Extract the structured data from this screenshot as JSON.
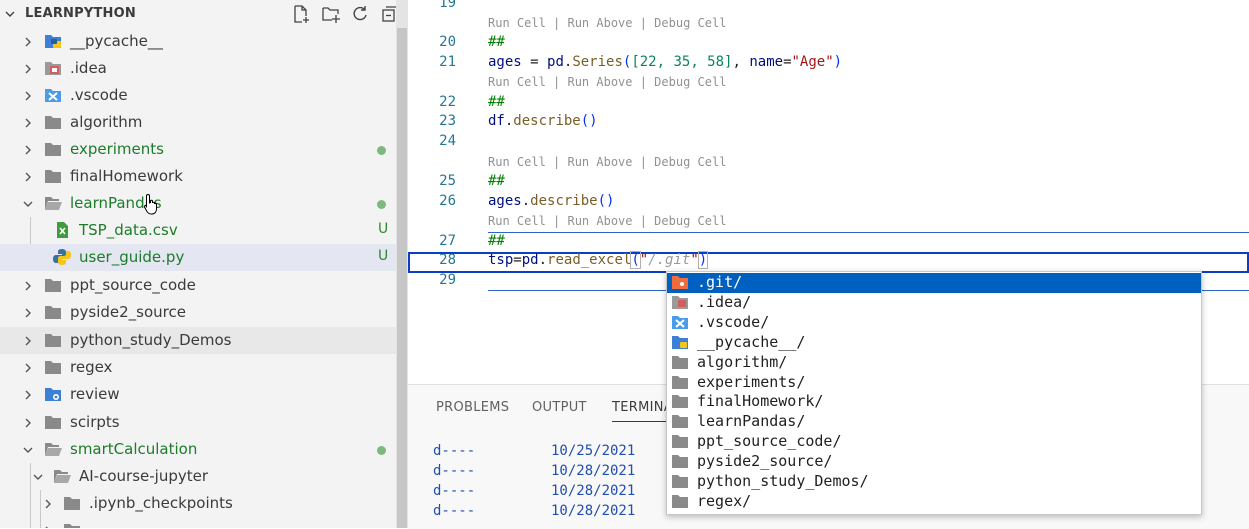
{
  "sidebar": {
    "title": "LEARNPYTHON",
    "tree": [
      {
        "label": "__pycache__",
        "icon": "python-cache-folder-icon",
        "status": ""
      },
      {
        "label": ".idea",
        "icon": "idea-folder-icon",
        "status": ""
      },
      {
        "label": ".vscode",
        "icon": "vscode-folder-icon",
        "status": ""
      },
      {
        "label": "algorithm",
        "icon": "folder-icon",
        "status": ""
      },
      {
        "label": "experiments",
        "icon": "folder-icon",
        "status": "modified"
      },
      {
        "label": "finalHomework",
        "icon": "folder-icon",
        "status": ""
      },
      {
        "label": "learnPandas",
        "icon": "folder-open-icon",
        "status": "modified"
      },
      {
        "label": "TSP_data.csv",
        "icon": "csv-file-icon",
        "status": "U"
      },
      {
        "label": "user_guide.py",
        "icon": "python-file-icon",
        "status": "U"
      },
      {
        "label": "ppt_source_code",
        "icon": "folder-icon",
        "status": ""
      },
      {
        "label": "pyside2_source",
        "icon": "folder-icon",
        "status": ""
      },
      {
        "label": "python_study_Demos",
        "icon": "folder-icon",
        "status": ""
      },
      {
        "label": "regex",
        "icon": "folder-icon",
        "status": ""
      },
      {
        "label": "review",
        "icon": "folder-icon",
        "status": ""
      },
      {
        "label": "scirpts",
        "icon": "folder-icon",
        "status": ""
      },
      {
        "label": "smartCalculation",
        "icon": "folder-open-icon",
        "status": "modified"
      },
      {
        "label": "AI-course-jupyter",
        "icon": "folder-open-icon",
        "status": ""
      },
      {
        "label": ".ipynb_checkpoints",
        "icon": "folder-icon",
        "status": ""
      }
    ]
  },
  "editor": {
    "codelens": "Run Cell | Run Above | Debug Cell",
    "line_numbers": [
      "19",
      "20",
      "21",
      "22",
      "23",
      "24",
      "25",
      "26",
      "27",
      "28",
      "29"
    ],
    "lines": {
      "l20": "##",
      "l21_var": "ages",
      "l21_eq": " = ",
      "l21_obj": "pd",
      "l21_dot": ".",
      "l21_fn": "Series",
      "l21_open": "(",
      "l21_list": "[22, 35, 58]",
      "l21_sep": ", ",
      "l21_kw": "name",
      "l21_eq2": "=",
      "l21_str": "\"Age\"",
      "l21_close": ")",
      "l22": "##",
      "l23_obj": "df",
      "l23_dot": ".",
      "l23_fn": "describe",
      "l23_par": "()",
      "l25": "##",
      "l26_obj": "ages",
      "l26_dot": ".",
      "l26_fn": "describe",
      "l26_par": "()",
      "l27": "##",
      "l28_var": "tsp",
      "l28_eq": "=",
      "l28_obj": "pd",
      "l28_dot": ".",
      "l28_fn": "read_excel",
      "l28_open": "(",
      "l28_str": "\"",
      "l28_ghost": "/.git",
      "l28_strend": "\"",
      "l28_close": ")"
    }
  },
  "panel": {
    "tabs": [
      "PROBLEMS",
      "OUTPUT",
      "TERMINAL"
    ],
    "active_tab": "TERMINAL",
    "terminal_rows": [
      {
        "mode": "d----",
        "date": "10/25/2021"
      },
      {
        "mode": "d----",
        "date": "10/28/2021"
      },
      {
        "mode": "d----",
        "date": "10/28/2021"
      },
      {
        "mode": "d----",
        "date": "10/28/2021"
      }
    ]
  },
  "suggest": {
    "items": [
      {
        "label": ".git/",
        "icon": "git-folder-icon"
      },
      {
        "label": ".idea/",
        "icon": "idea-folder-icon"
      },
      {
        "label": ".vscode/",
        "icon": "vscode-folder-icon"
      },
      {
        "label": "__pycache__/",
        "icon": "python-cache-folder-icon"
      },
      {
        "label": "algorithm/",
        "icon": "folder-icon"
      },
      {
        "label": "experiments/",
        "icon": "folder-icon"
      },
      {
        "label": "finalHomework/",
        "icon": "folder-icon"
      },
      {
        "label": "learnPandas/",
        "icon": "folder-icon"
      },
      {
        "label": "ppt_source_code/",
        "icon": "folder-icon"
      },
      {
        "label": "pyside2_source/",
        "icon": "folder-icon"
      },
      {
        "label": "python_study_Demos/",
        "icon": "folder-icon"
      },
      {
        "label": "regex/",
        "icon": "folder-icon"
      }
    ]
  },
  "colors": {
    "accent": "#0060c0",
    "git_untracked": "#2f8b2f",
    "line_number": "#237893"
  }
}
